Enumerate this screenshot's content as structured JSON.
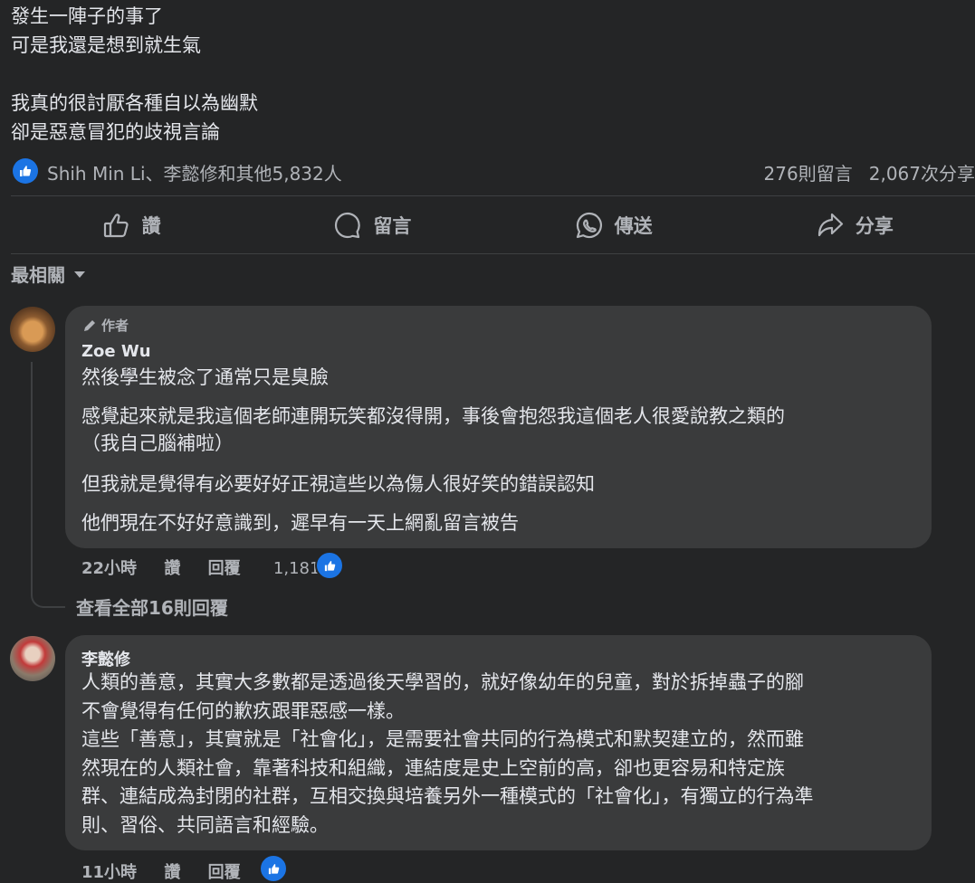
{
  "post": {
    "lines": [
      "發生一陣子的事了",
      "可是我還是想到就生氣",
      "",
      "我真的很討厭各種自以為幽默",
      "卻是惡意冒犯的歧視言論"
    ]
  },
  "stats": {
    "reactors": "Shih Min Li、李懿修和其他5,832人",
    "comments": "276則留言",
    "shares": "2,067次分享"
  },
  "actions": {
    "like": "讚",
    "comment": "留言",
    "send": "傳送",
    "share": "分享"
  },
  "sort": {
    "label": "最相關"
  },
  "comments": [
    {
      "badge": "作者",
      "name": "Zoe Wu",
      "paragraphs": [
        "然後學生被念了通常只是臭臉",
        "感覺起來就是我這個老師連開玩笑都沒得開，事後會抱怨我這個老人很愛說教之類的\n（我自己腦補啦）",
        "但我就是覺得有必要好好正視這些以為傷人很好笑的錯誤認知",
        "他們現在不好好意識到，遲早有一天上網亂留言被告"
      ],
      "time": "22小時",
      "like": "讚",
      "reply": "回覆",
      "reaction_count": "1,181",
      "view_replies": "查看全部16則回覆"
    },
    {
      "name": "李懿修",
      "text": "人類的善意，其實大多數都是透過後天學習的，就好像幼年的兒童，對於拆掉蟲子的腳\n不會覺得有任何的歉疚跟罪惡感一樣。\n這些「善意」，其實就是「社會化」，是需要社會共同的行為模式和默契建立的，然而雖\n然現在的人類社會，靠著科技和組織，連結度是史上空前的高，卻也更容易和特定族\n群、連結成為封閉的社群，互相交換與培養另外一種模式的「社會化」，有獨立的行為準\n則、習俗、共同語言和經驗。",
      "time": "11小時",
      "like": "讚",
      "reply": "回覆"
    }
  ]
}
